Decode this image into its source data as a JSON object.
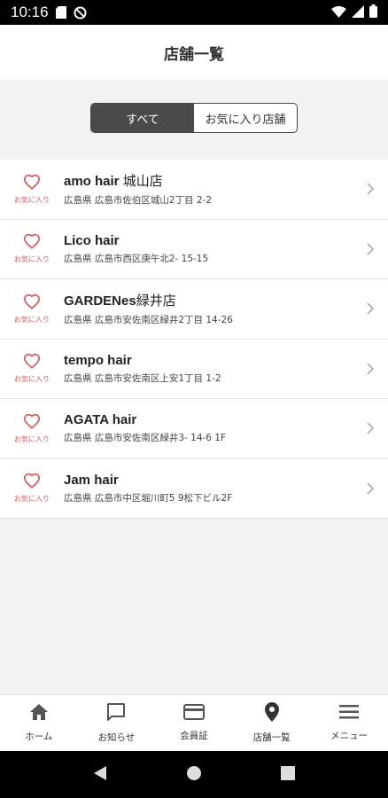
{
  "status_bar": {
    "time": "10:16"
  },
  "header": {
    "title": "店舗一覧"
  },
  "segment": {
    "options": [
      {
        "label": "すべて",
        "selected": true
      },
      {
        "label": "お気に入り店舗",
        "selected": false
      }
    ]
  },
  "stores": [
    {
      "name": "amo hair ",
      "name_jp": "城山店",
      "address": "広島県 広島市佐伯区城山2丁目 2-2",
      "fav_label": "お気に入り"
    },
    {
      "name": "Lico hair",
      "name_jp": "",
      "address": "広島県 広島市西区庚午北2- 15-15",
      "fav_label": "お気に入り"
    },
    {
      "name": "GARDENes",
      "name_jp": "緑井店",
      "address": "広島県 広島市安佐南区緑井2丁目 14-26",
      "fav_label": "お気に入り"
    },
    {
      "name": "tempo hair",
      "name_jp": "",
      "address": "広島県 広島市安佐南区上安1丁目 1-2",
      "fav_label": "お気に入り"
    },
    {
      "name": "AGATA hair",
      "name_jp": "",
      "address": "広島県 広島市安佐南区緑井3- 14-6 1F",
      "fav_label": "お気に入り"
    },
    {
      "name": "Jam hair",
      "name_jp": "",
      "address": "広島県 広島市中区堀川町5 9松下ビル2F",
      "fav_label": "お気に入り"
    }
  ],
  "bottom_nav": [
    {
      "label": "ホーム",
      "icon": "home-icon"
    },
    {
      "label": "お知らせ",
      "icon": "message-icon"
    },
    {
      "label": "会員証",
      "icon": "card-icon"
    },
    {
      "label": "店舗一覧",
      "icon": "location-pin-icon"
    },
    {
      "label": "メニュー",
      "icon": "menu-icon"
    }
  ],
  "colors": {
    "accent_red": "#e05555",
    "segment_active": "#4a4a4a",
    "background": "#f2f2f2"
  }
}
